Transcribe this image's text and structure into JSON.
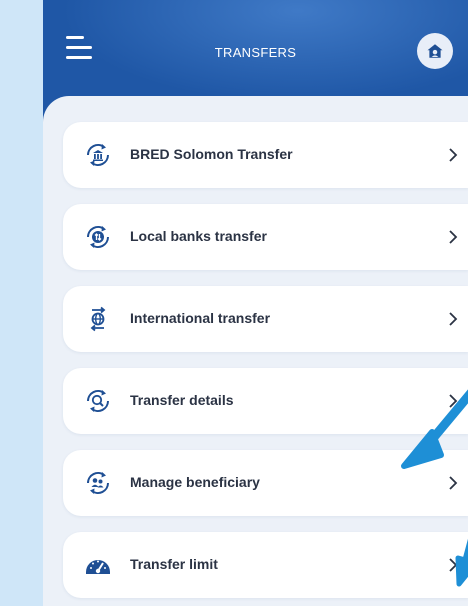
{
  "header": {
    "title": "TRANSFERS"
  },
  "menu": {
    "items": [
      {
        "label": "BRED Solomon Transfer",
        "icon": "bank-transfer-icon"
      },
      {
        "label": "Local banks transfer",
        "icon": "local-transfer-icon"
      },
      {
        "label": "International transfer",
        "icon": "globe-transfer-icon"
      },
      {
        "label": "Transfer details",
        "icon": "search-transfer-icon"
      },
      {
        "label": "Manage beneficiary",
        "icon": "beneficiary-icon"
      },
      {
        "label": "Transfer limit",
        "icon": "speedometer-icon"
      }
    ]
  },
  "colors": {
    "header_bg": "#1f57a6",
    "panel_bg": "#ecf1f8",
    "accent_icon": "#1f4f94",
    "annotation_arrow": "#1e8fd6"
  }
}
